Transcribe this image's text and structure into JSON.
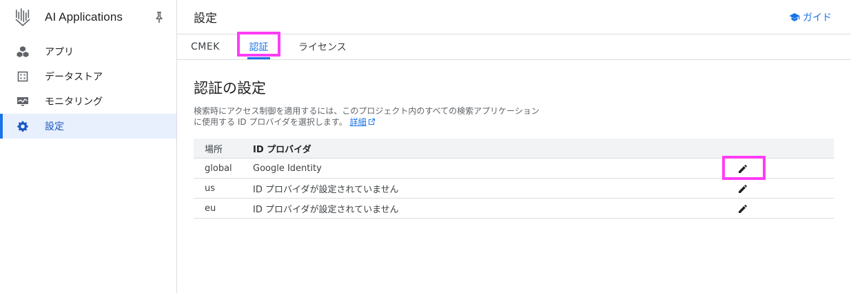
{
  "app": {
    "title": "AI Applications"
  },
  "sidebar": {
    "items": [
      {
        "label": "アプリ",
        "icon": "cubes-icon"
      },
      {
        "label": "データストア",
        "icon": "datastore-icon"
      },
      {
        "label": "モニタリング",
        "icon": "monitoring-icon"
      },
      {
        "label": "設定",
        "icon": "gear-icon",
        "active": true
      }
    ]
  },
  "header": {
    "title": "設定",
    "guide_label": "ガイド"
  },
  "tabs": [
    {
      "label": "CMEK"
    },
    {
      "label": "認証",
      "selected": true
    },
    {
      "label": "ライセンス"
    }
  ],
  "section": {
    "title": "認証の設定",
    "desc_line1": "検索時にアクセス制御を適用するには、このプロジェクト内のすべての検索アプリケーション",
    "desc_line2": "に使用する ID プロバイダを選択します。",
    "link_label": "詳細"
  },
  "table": {
    "headers": [
      "場所",
      "ID プロバイダ"
    ],
    "rows": [
      {
        "location": "global",
        "provider": "Google Identity"
      },
      {
        "location": "us",
        "provider": "ID プロバイダが設定されていません"
      },
      {
        "location": "eu",
        "provider": "ID プロバイダが設定されていません"
      }
    ]
  },
  "colors": {
    "accent": "#1a73e8",
    "highlight": "#ff3df5",
    "active_bg": "#e8f0fe"
  }
}
